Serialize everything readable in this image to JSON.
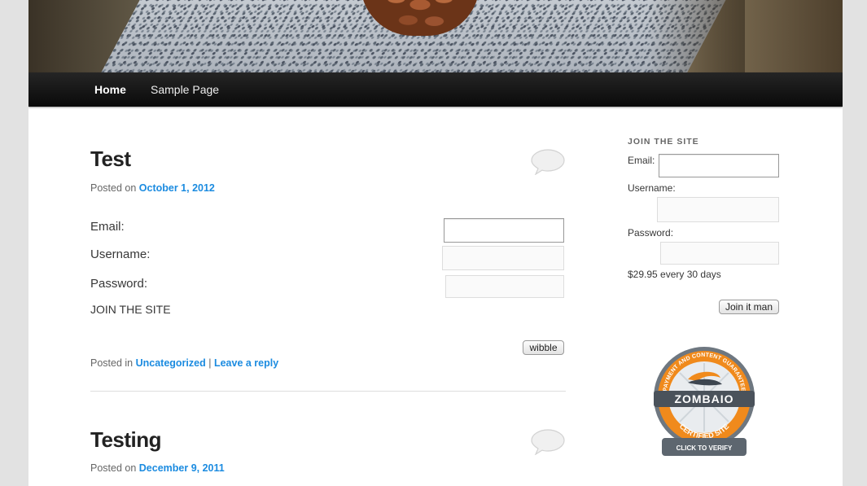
{
  "nav": {
    "home": "Home",
    "sample_page": "Sample Page"
  },
  "posts": [
    {
      "title": "Test",
      "posted_on": "Posted on",
      "date": "October 1, 2012",
      "form": {
        "email_label": "Email:",
        "username_label": "Username:",
        "password_label": "Password:",
        "join_text": "JOIN THE SITE",
        "button": "wibble"
      },
      "posted_in": "Posted in",
      "category": "Uncategorized",
      "separator": "|",
      "reply": "Leave a reply"
    },
    {
      "title": "Testing",
      "posted_on": "Posted on",
      "date": "December 9, 2011"
    }
  ],
  "sidebar": {
    "title": "JOIN THE SITE",
    "email_label": "Email:",
    "username_label": "Username:",
    "password_label": "Password:",
    "price": "$29.95 every 30 days",
    "button": "Join it man"
  },
  "badge": {
    "arc_text": "PAYMENT AND CONTENT GUARANTEE",
    "brand": "ZOMBAIO",
    "certified": "CERTIFIED SITE",
    "verify": "CLICK TO VERIFY"
  },
  "colors": {
    "link": "#1b8be0",
    "nav_bg": "#111111",
    "badge_orange": "#f08a1c"
  },
  "icons": [
    "comment-bubble-icon",
    "zombaio-badge-icon"
  ]
}
